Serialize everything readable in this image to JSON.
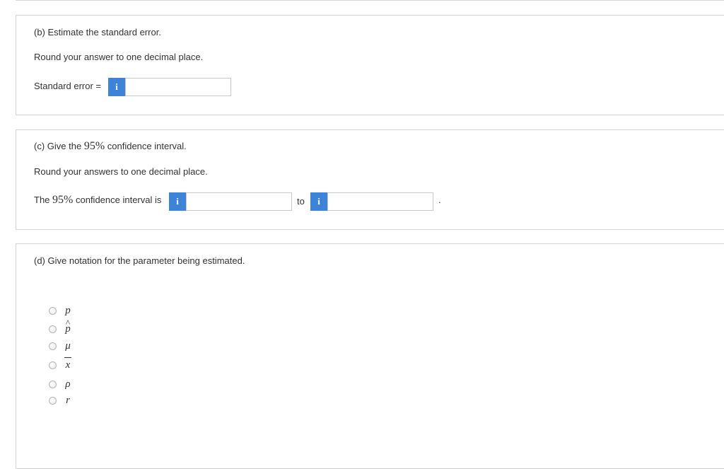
{
  "part_b": {
    "question": "(b) Estimate the standard error.",
    "instruction": "Round your answer to one decimal place.",
    "field_label": "Standard error =",
    "info_icon_text": "i",
    "answer_value": ""
  },
  "part_c": {
    "question_prefix": "(c) Give the",
    "question_math": "95%",
    "question_suffix": "confidence interval.",
    "instruction": "Round your answers to one decimal place.",
    "field_prefix": "The",
    "field_math": "95%",
    "field_suffix": "confidence interval is",
    "info_icon_text": "i",
    "lower_value": "",
    "connector": "to",
    "upper_value": "",
    "end_period": "."
  },
  "part_d": {
    "question": "(d) Give notation for the parameter being estimated.",
    "options": [
      {
        "symbol": "p"
      },
      {
        "symbol": "p"
      },
      {
        "symbol": "μ"
      },
      {
        "symbol": "x"
      },
      {
        "symbol": "ρ"
      },
      {
        "symbol": "r"
      }
    ]
  },
  "colors": {
    "info_button": "#3d84d8",
    "card_border": "#d4d4d4",
    "text": "#333333"
  }
}
